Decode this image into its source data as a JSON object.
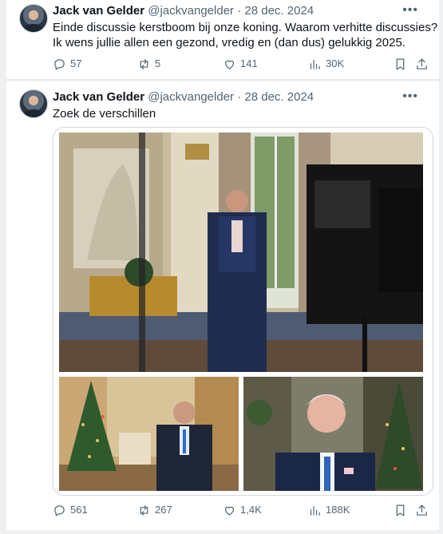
{
  "tweets": [
    {
      "name": "Jack van Gelder",
      "handle": "@jackvangelder",
      "separator": "·",
      "date": "28 dec. 2024",
      "text_lines": [
        "Einde discussie kerstboom bij onze koning. Waarom verhitte discussies?",
        "Ik wens jullie allen een gezond, vredig en (dan dus) gelukkig  2025."
      ],
      "stats": {
        "replies": "57",
        "reposts": "5",
        "likes": "141",
        "views": "30K"
      }
    },
    {
      "name": "Jack van Gelder",
      "handle": "@jackvangelder",
      "separator": "·",
      "date": "28 dec. 2024",
      "text_lines": [
        "Zoek de verschillen"
      ],
      "stats": {
        "replies": "561",
        "reposts": "267",
        "likes": "1,4K",
        "views": "188K"
      }
    }
  ],
  "icons": {
    "more": "more-dots-icon",
    "reply": "reply-icon",
    "repost": "repost-icon",
    "like": "like-icon",
    "views": "views-icon",
    "bookmark": "bookmark-icon",
    "share": "share-icon"
  },
  "colors": {
    "text": "#0f1419",
    "muted": "#536471",
    "border": "#cfd9de"
  }
}
